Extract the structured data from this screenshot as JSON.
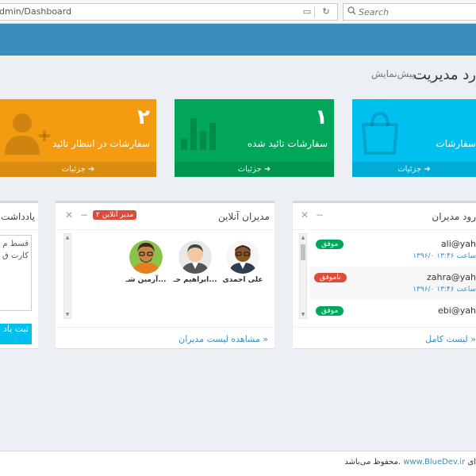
{
  "browser": {
    "url": "dmin/Dashboard",
    "search_placeholder": "Search"
  },
  "header": {
    "title": "رد مدیریت",
    "subtitle": "پیش‌نمایش"
  },
  "stats": [
    {
      "number": "۲",
      "label": "سفارشات در انتظار تائید",
      "footer": "جزئیات",
      "color": "#f39c12",
      "icon": "add-user-icon"
    },
    {
      "number": "۱",
      "label": "سفارشات تائید شده",
      "footer": "جزئیات",
      "color": "#00a65a",
      "icon": "bar-chart-icon"
    },
    {
      "number": "",
      "label": "سفارشات",
      "footer": "جزئیات",
      "color": "#00c0ef",
      "icon": "shopping-bag-icon"
    }
  ],
  "notes": {
    "title": "یادداشت",
    "text": "قسط م کارت ق",
    "submit_label": "ثبت یاد"
  },
  "online": {
    "title": "مدیران آنلاین",
    "badge": "۲ مدیر آنلاین",
    "users": [
      {
        "name": "علی احمدی",
        "icon": "admin-avatar-icon"
      },
      {
        "name": "ابراهیم حـ...",
        "icon": "admin-avatar-icon"
      },
      {
        "name": "آرمین شـ...",
        "icon": "admin-avatar-icon"
      }
    ],
    "footer_link": "مشاهده لیست مدیران »"
  },
  "logins": {
    "title": "رود مدیران",
    "rows": [
      {
        "email": "ali@yah",
        "time": "۱۳۹۶/۰ ساعت ۱۳:۴۶",
        "status": "موفق",
        "ok": true
      },
      {
        "email": "zahra@yah",
        "time": "۱۳۹۶/۰ ساعت ۱۳:۴۶",
        "status": "ناموفق",
        "ok": false
      },
      {
        "email": "ebi@yah",
        "time": "",
        "status": "موفق",
        "ok": true
      }
    ],
    "footer_link": "لیست کامل »"
  },
  "footer": {
    "prefix": "ای",
    "link": "www.BlueDev.ir",
    "suffix": "محفوظ می‌باشد."
  },
  "colors": {
    "nav": "#3c8dbc",
    "orange": "#f39c12",
    "green": "#00a65a",
    "cyan": "#00c0ef",
    "red": "#dd4b39"
  }
}
